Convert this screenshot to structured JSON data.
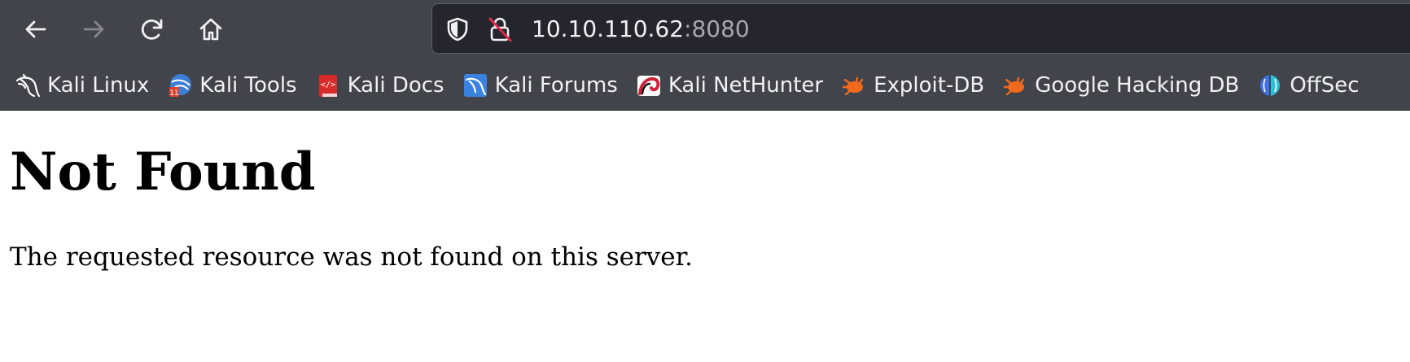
{
  "browser": {
    "url": {
      "host": "10.10.110.62",
      "port": ":8080"
    },
    "nav": {
      "back_icon": "arrow-left-icon",
      "forward_icon": "arrow-right-icon",
      "reload_icon": "reload-icon",
      "home_icon": "home-icon"
    },
    "bookmarks": [
      {
        "label": "Kali Linux",
        "icon": "kali-dragon-icon"
      },
      {
        "label": "Kali Tools",
        "icon": "kali-tools-icon"
      },
      {
        "label": "Kali Docs",
        "icon": "kali-docs-icon"
      },
      {
        "label": "Kali Forums",
        "icon": "kali-forums-icon"
      },
      {
        "label": "Kali NetHunter",
        "icon": "nethunter-icon"
      },
      {
        "label": "Exploit-DB",
        "icon": "exploit-db-icon"
      },
      {
        "label": "Google Hacking DB",
        "icon": "ghdb-icon"
      },
      {
        "label": "OffSec",
        "icon": "offsec-icon"
      }
    ],
    "colors": {
      "chrome": "#42444b",
      "url_bar": "#24252d",
      "text": "#f2f2f4",
      "port_text": "#a7a8ad"
    }
  },
  "page": {
    "title": "Not Found",
    "message": "The requested resource was not found on this server."
  }
}
